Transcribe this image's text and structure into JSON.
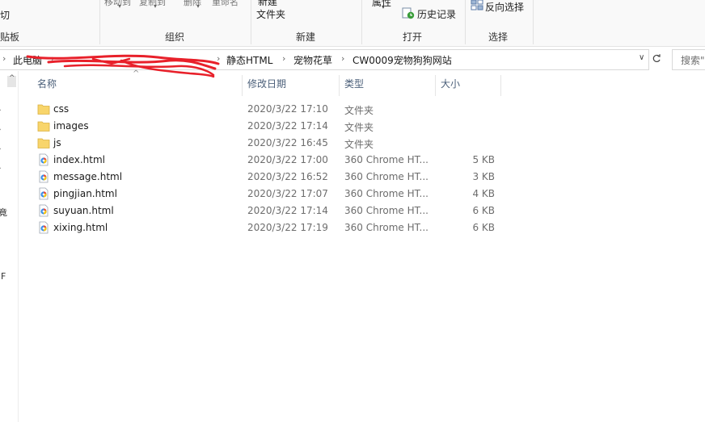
{
  "ribbon": {
    "clipboard": {
      "cut_label": "剪切",
      "group_label": "剪贴板"
    },
    "organize": {
      "move_to_label": "移动到",
      "copy_to_label": "复制到",
      "delete_label": "删除",
      "rename_label": "重命名",
      "group_label": "组织"
    },
    "new": {
      "new_label": "新建",
      "folder_label": "文件夹",
      "group_label": "新建"
    },
    "open": {
      "properties_label": "属性",
      "history_label": "历史记录",
      "group_label": "打开"
    },
    "select": {
      "invert_label": "反向选择",
      "group_label": "选择"
    }
  },
  "address_bar": {
    "breadcrumbs": [
      "此电脑",
      "静态HTML",
      "宠物花草",
      "CW0009宠物狗狗网站"
    ],
    "search_placeholder": "搜索\""
  },
  "columns": {
    "name": "名称",
    "date": "修改日期",
    "type": "类型",
    "size": "大小"
  },
  "files": [
    {
      "name": "css",
      "date": "2020/3/22 17:10",
      "type": "文件夹",
      "size": "",
      "icon": "folder-icon"
    },
    {
      "name": "images",
      "date": "2020/3/22 17:14",
      "type": "文件夹",
      "size": "",
      "icon": "folder-icon"
    },
    {
      "name": "js",
      "date": "2020/3/22 16:45",
      "type": "文件夹",
      "size": "",
      "icon": "folder-icon"
    },
    {
      "name": "index.html",
      "date": "2020/3/22 17:00",
      "type": "360 Chrome HT...",
      "size": "5 KB",
      "icon": "browser-html-icon"
    },
    {
      "name": "message.html",
      "date": "2020/3/22 16:52",
      "type": "360 Chrome HT...",
      "size": "3 KB",
      "icon": "browser-html-icon"
    },
    {
      "name": "pingjian.html",
      "date": "2020/3/22 17:07",
      "type": "360 Chrome HT...",
      "size": "4 KB",
      "icon": "browser-html-icon"
    },
    {
      "name": "suyuan.html",
      "date": "2020/3/22 17:14",
      "type": "360 Chrome HT...",
      "size": "6 KB",
      "icon": "browser-html-icon"
    },
    {
      "name": "xixing.html",
      "date": "2020/3/22 17:19",
      "type": "360 Chrome HT...",
      "size": "6 KB",
      "icon": "browser-html-icon"
    }
  ],
  "colors": {
    "folder": "#f8d56b",
    "scribble": "#e8202a",
    "header_text": "#4c607a"
  }
}
